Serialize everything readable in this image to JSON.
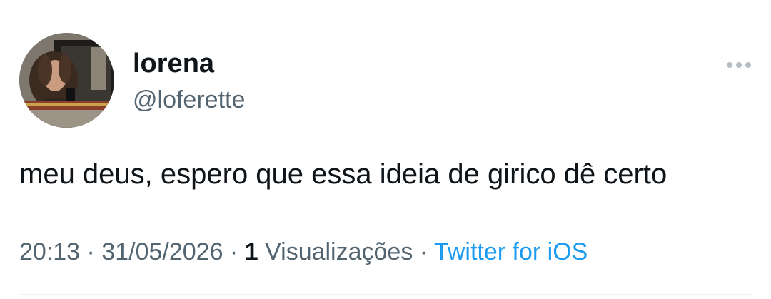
{
  "user": {
    "display_name": "lorena",
    "handle": "@loferette",
    "avatar": "profile-photo"
  },
  "tweet": {
    "text": "meu deus, espero que essa ideia de girico dê certo"
  },
  "meta": {
    "time": "20:13",
    "separator": " · ",
    "date": "31/05/2026",
    "views_count": "1",
    "views_label": " Visualizações",
    "source": "Twitter for iOS"
  },
  "icons": {
    "more": "more-horizontal-icon"
  },
  "colors": {
    "text": "#0f1419",
    "secondary": "#536471",
    "link": "#1d9bf0",
    "divider": "#eff3f4"
  }
}
